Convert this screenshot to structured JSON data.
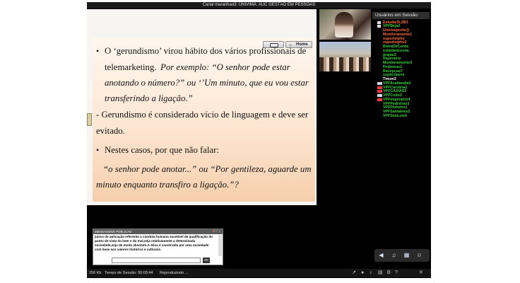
{
  "window": {
    "title": "Canal maranhao3: UNIVIMA: AUC GESTÃO EM PESSOAS"
  },
  "slide": {
    "nav": {
      "home_label": "Home",
      "home_icon": "house-icon",
      "prev_icon": "back-arrow-icon"
    },
    "lines": [
      "O ‘gerundismo’ virou hábito dos vários profissionais de",
      "telemarketing.",
      "Por exemplo: “O senhor pode estar",
      "anotando o número?” ou ‘’Um minuto, que eu vou estar",
      "transferindo a ligação.”",
      "- Gerundismo é considerado vício de linguagem e deve ser",
      "evitado.",
      "Nestes casos, por que não falar:",
      "“o senhor pode anotar...” ou “Por gentileza, aguarde um",
      "minuto enquanto transfiro a ligação.”?"
    ],
    "bullet": "•"
  },
  "users": {
    "header": "Usuários em Sessão",
    "list": [
      {
        "name": "Estudio3L2B3",
        "color": "#ff6a3d",
        "icon": "mic-icon"
      },
      {
        "name": "VPFBeja2",
        "color": "#39d13a",
        "icon": "mic-icon"
      },
      {
        "name": "Univisuporte@",
        "color": "#ff6a3d",
        "icon": ""
      },
      {
        "name": "Monitoramento1",
        "color": "#ff6a3d",
        "icon": ""
      },
      {
        "name": "suporteiphu",
        "color": "#ff6a3d",
        "icon": ""
      },
      {
        "name": "suporteiphu2",
        "color": "#ff6a3d",
        "icon": ""
      },
      {
        "name": "BarraDoCorda",
        "color": "#39d13a",
        "icon": ""
      },
      {
        "name": "estatdeiescola",
        "color": "#39d13a",
        "icon": ""
      },
      {
        "name": "grajau3",
        "color": "#39d13a",
        "icon": ""
      },
      {
        "name": "Imperatriz",
        "color": "#39d13a",
        "icon": ""
      },
      {
        "name": "Monitoramento3",
        "color": "#39d13a",
        "icon": ""
      },
      {
        "name": "Pedreiras1",
        "color": "#39d13a",
        "icon": ""
      },
      {
        "name": "Recepcao7",
        "color": "#39d13a",
        "icon": ""
      },
      {
        "name": "suptecbarra",
        "color": "#39d13a",
        "icon": ""
      },
      {
        "name": "Timon3",
        "color": "#ffffff",
        "icon": ""
      },
      {
        "name": "VPFAcailandia3",
        "color": "#39d13a",
        "icon": "camera-icon"
      },
      {
        "name": "VPFCarolina2",
        "color": "#39d13a",
        "icon": "camera-off-icon"
      },
      {
        "name": "VPFCAXIAS3",
        "color": "#39d13a",
        "icon": "camera-off-icon"
      },
      {
        "name": "VPFCodo3",
        "color": "#39d13a",
        "icon": "camera-icon"
      },
      {
        "name": "VPFImperatriz4",
        "color": "#39d13a",
        "icon": "camera-off-icon"
      },
      {
        "name": "VPFPedreiras3",
        "color": "#39d13a",
        "icon": ""
      },
      {
        "name": "VPFPinheiro1",
        "color": "#39d13a",
        "icon": ""
      },
      {
        "name": "VPFSantaInes2",
        "color": "#39d13a",
        "icon": ""
      },
      {
        "name": "VPFSaoLuis4",
        "color": "#39d13a",
        "icon": ""
      }
    ]
  },
  "chat": {
    "header": "MENSAGENS PÚBLICAS",
    "header_icons": [
      "font-size-icon",
      "scroll-up-icon",
      "scroll-down-icon"
    ],
    "message": "juízos de aplicação referente a conduta humana sucetível de qualificação do ponto de vista do bem e do mal,seja relativamente a determinada sociedade,seja de modo absoluto.A ética é construída por uma sociedade com base nos valores histórico e culturais.",
    "input_value": "",
    "send_label": "OK"
  },
  "statusbar": {
    "bandwidth": "256 Kb",
    "session_time": "Tempo de Sessão: 00:03:44",
    "status": "Reproduzindo ...",
    "icons": [
      "fullscreen-icon",
      "record-icon",
      "volume-icon",
      "chat-icon",
      "settings-icon",
      "help-icon",
      "close-icon"
    ]
  },
  "controls": {
    "icons": [
      "speaker-icon",
      "microphone-icon",
      "layout-icon",
      "users-icon"
    ]
  }
}
